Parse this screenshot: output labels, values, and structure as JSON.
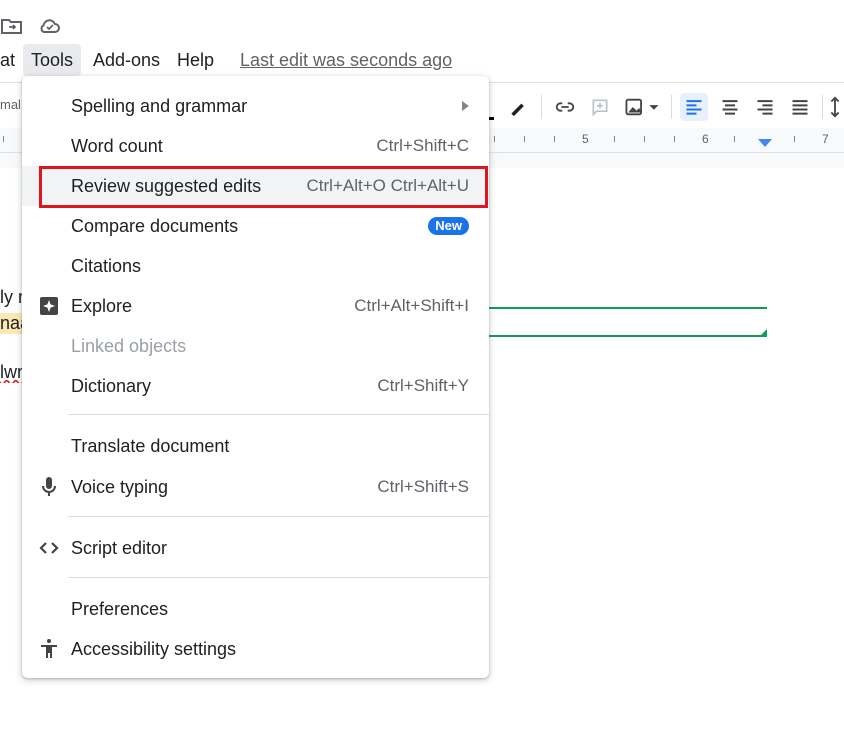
{
  "menubar": {
    "format_partial": "at",
    "tools": "Tools",
    "addons": "Add-ons",
    "help": "Help",
    "last_edit": "Last edit was seconds ago"
  },
  "toolbar": {
    "style_partial": "mal"
  },
  "ruler": {
    "n5": "5",
    "n6": "6",
    "n7": "7"
  },
  "doc": {
    "frag1": "ly r",
    "frag2": "naa",
    "frag3": "lwr"
  },
  "tools_menu": {
    "spelling": "Spelling and grammar",
    "word_count": "Word count",
    "word_count_sc": "Ctrl+Shift+C",
    "review": "Review suggested edits",
    "review_sc": "Ctrl+Alt+O Ctrl+Alt+U",
    "compare": "Compare documents",
    "compare_badge": "New",
    "citations": "Citations",
    "explore": "Explore",
    "explore_sc": "Ctrl+Alt+Shift+I",
    "linked": "Linked objects",
    "dictionary": "Dictionary",
    "dictionary_sc": "Ctrl+Shift+Y",
    "translate": "Translate document",
    "voice": "Voice typing",
    "voice_sc": "Ctrl+Shift+S",
    "script": "Script editor",
    "preferences": "Preferences",
    "accessibility": "Accessibility settings"
  },
  "colors": {
    "accent_blue": "#1a73e8",
    "highlight_red": "#e0161e",
    "suggestion_green": "#0f9d58"
  }
}
